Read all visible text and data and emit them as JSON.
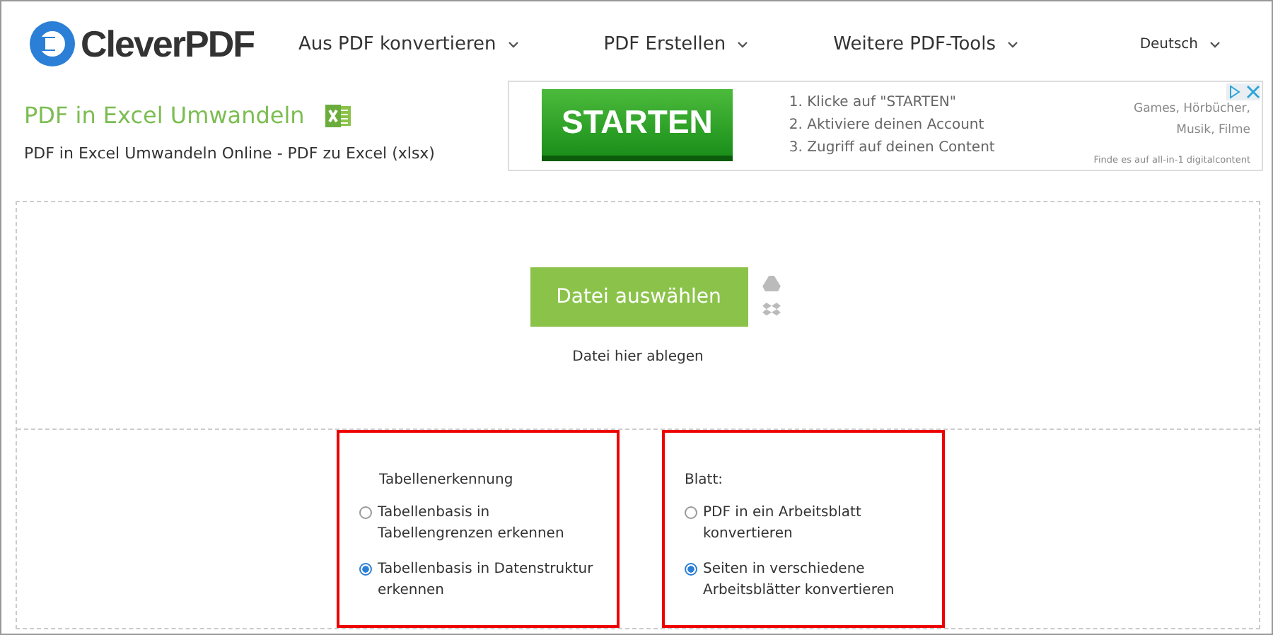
{
  "header": {
    "logo": "CleverPDF",
    "nav": [
      {
        "label": "Aus PDF konvertieren"
      },
      {
        "label": "PDF Erstellen"
      },
      {
        "label": "Weitere PDF-Tools"
      }
    ],
    "language": "Deutsch"
  },
  "page": {
    "title": "PDF in Excel Umwandeln",
    "subtitle": "PDF in Excel Umwandeln Online - PDF zu Excel (xlsx)"
  },
  "ad": {
    "button": "STARTEN",
    "steps": [
      "1. Klicke auf \"STARTEN\"",
      "2. Aktiviere deinen Account",
      "3. Zugriff auf deinen Content"
    ],
    "tags": [
      "Games, Hörbücher,",
      "Musik, Filme"
    ],
    "footer": "Finde es auf all-in-1 digitalcontent"
  },
  "upload": {
    "button": "Datei auswählen",
    "hint": "Datei hier ablegen"
  },
  "options": [
    {
      "title": "Tabellenerkennung",
      "choices": [
        {
          "label": "Tabellenbasis in Tabellengrenzen erkennen",
          "selected": false
        },
        {
          "label": "Tabellenbasis in Datenstruktur erkennen",
          "selected": true
        }
      ]
    },
    {
      "title": "Blatt:",
      "choices": [
        {
          "label": "PDF in ein Arbeitsblatt konvertieren",
          "selected": false
        },
        {
          "label": "Seiten in verschiedene Arbeitsblätter konvertieren",
          "selected": true
        }
      ]
    }
  ]
}
